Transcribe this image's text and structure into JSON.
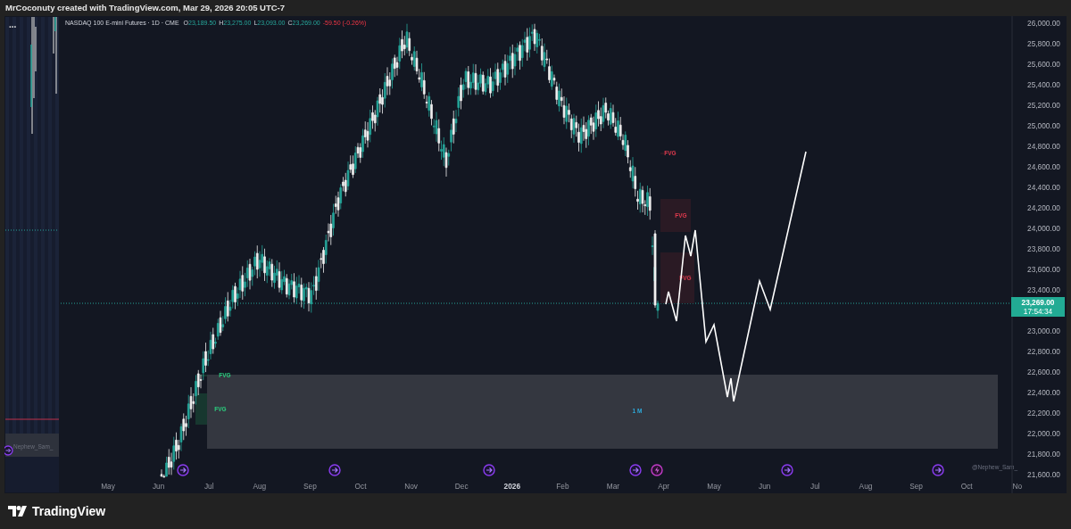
{
  "header": {
    "title": "MrCoconuty created with TradingView.com, Mar 29, 2026 20:05 UTC-7"
  },
  "legend": {
    "symbol": "NASDAQ 100 E-mini Futures · 1D · CME",
    "ohlc": [
      {
        "label": "O",
        "value": "23,189.50"
      },
      {
        "label": "H",
        "value": "23,275.00"
      },
      {
        "label": "L",
        "value": "23,093.00"
      },
      {
        "label": "C",
        "value": "23,269.00"
      }
    ],
    "change": "-59.50 (-0.26%)"
  },
  "side_panel": {
    "menu": "...",
    "author": "Nephew_Sam_"
  },
  "zones": [
    {
      "kind": "bearish",
      "label": "FVG"
    },
    {
      "kind": "bearish",
      "label": "FVG"
    },
    {
      "kind": "bearish",
      "label": "FVG"
    },
    {
      "kind": "bullish",
      "label": "FVG"
    },
    {
      "kind": "bullish",
      "label": "FVG"
    },
    {
      "kind": "range",
      "label": "1 M"
    }
  ],
  "author_tag": "@Nephew_Sam_",
  "price_axis": {
    "labels": [
      "26,000.00",
      "25,800.00",
      "25,600.00",
      "25,400.00",
      "25,200.00",
      "25,000.00",
      "24,800.00",
      "24,600.00",
      "24,400.00",
      "24,200.00",
      "24,000.00",
      "23,800.00",
      "23,600.00",
      "23,400.00",
      "23,000.00",
      "22,800.00",
      "22,600.00",
      "22,400.00",
      "22,200.00",
      "22,000.00",
      "21,800.00",
      "21,600.00"
    ],
    "last_price": "23,269.00",
    "countdown": "17:54:34"
  },
  "time_axis": {
    "labels": [
      {
        "label": "May",
        "year": false
      },
      {
        "label": "Jun",
        "year": false
      },
      {
        "label": "Jul",
        "year": false
      },
      {
        "label": "Aug",
        "year": false
      },
      {
        "label": "Sep",
        "year": false
      },
      {
        "label": "Oct",
        "year": false
      },
      {
        "label": "Nov",
        "year": false
      },
      {
        "label": "Dec",
        "year": false
      },
      {
        "label": "2026",
        "year": true
      },
      {
        "label": "Feb",
        "year": false
      },
      {
        "label": "Mar",
        "year": false
      },
      {
        "label": "Apr",
        "year": false
      },
      {
        "label": "May",
        "year": false
      },
      {
        "label": "Jun",
        "year": false
      },
      {
        "label": "Jul",
        "year": false
      },
      {
        "label": "Aug",
        "year": false
      },
      {
        "label": "Sep",
        "year": false
      },
      {
        "label": "Oct",
        "year": false
      },
      {
        "label": "No",
        "year": false
      }
    ]
  },
  "brand": {
    "name": "TradingView"
  }
}
